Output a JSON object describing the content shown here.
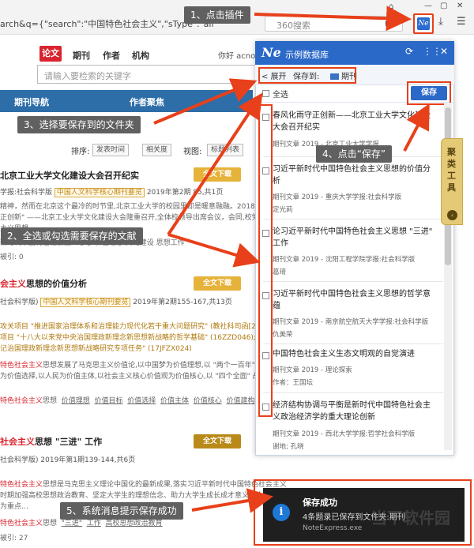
{
  "browser": {
    "url": "arch&q={\"search\":\"中国特色社会主义\",\"sType\":\"all\"}&",
    "search_placeholder": "360搜索"
  },
  "site": {
    "tabs": [
      "论文",
      "期刊",
      "作者",
      "机构"
    ],
    "greeting": "你好 acno",
    "keyword_placeholder": "请输入要检索的关键字",
    "nav": [
      "期刊导航",
      "作者聚焦"
    ],
    "sort_label": "排序:",
    "sort_chips": [
      "发表时间",
      "相关度"
    ],
    "view_label": "视图:",
    "view_chip": "标题列表"
  },
  "articles": [
    {
      "title": "北京工业大学文化建设大会召开纪实",
      "source": "学报:社会科学版",
      "tag": "中国人文科学核心期刊要览",
      "issue": "2019年第2期",
      "pages": "85,共1页",
      "lines": [
        "精神，然而在北京这个最冷的时节里,北京工业大学的校园里却是暖意融融。2018年12月",
        "正创新\" ——北京工业大学文化建设大会隆重召开,全体校领导出席会议，会同,校党委",
        "主义思想"
      ],
      "keyword_line": "新时代中国特色社会主义思想  价值理念  文化建设  思想工作",
      "count_label": "被引:",
      "count": "0",
      "download": "全文下载"
    },
    {
      "title_red": "会主义",
      "title": "思想的价值分析",
      "source": "社会科学版)",
      "tag": "中国人文科学核心期刊要览",
      "issue": "2019年第2期155-167,共13页",
      "lines": [
        "攻关项目 \"推进国家治理体系和治理能力现代化若干重大问题研究\" (教社科司函[2014",
        "项目 \"十八大以来党中央治国理政新理念新思想新战略的哲学基础\" (16ZZD046);教",
        "记治国理政新理念新思想新战略研究专项任务\" (17JFZX024)"
      ],
      "body_red": "特色社会主义",
      "body": "思想发展了马克思主义价值论,以中国梦为价值理想,以 \"两个一百年\" 为",
      "body2": "为价值选择,以人民为价值主体,以社会主义核心价值观为价值核心,以 \"四个全面\" 战略",
      "keywords": [
        "思想",
        "价值理想",
        "价值目标",
        "价值选择",
        "价值主体",
        "价值核心",
        "价值建构"
      ],
      "keyword_prefix": "特色社会主义",
      "download": "全文下载"
    },
    {
      "title_red": "社会主义",
      "title": "思想 \"三进\" 工作",
      "source": "社会科学版)",
      "issue": "2019年第1期139-144,共6页",
      "body_red": "特色社会主义",
      "body": "思想是马克思主义理论中国化的最新成果,落实习近平新时代中国特色社会主义",
      "body2": "时期加强高校思想政治教育、坚定大学生的理想信念、助力大学生成长成才意义重大。为",
      "body3": "为重点…",
      "keywords": [
        "思想",
        "\"三进\"",
        "工作",
        "高校思想政治教育"
      ],
      "keyword_prefix": "特色社会主义",
      "count_label": "被引:",
      "count": "27",
      "download": "全文下载"
    }
  ],
  "panel": {
    "title": "示例数据库",
    "expand": "< 展开",
    "save_to": "保存到:",
    "folder": "期刊",
    "select_all": "全选",
    "save": "保存",
    "items": [
      {
        "title": "春风化雨守正创新——北京工业大学文化建设大会召开纪实",
        "meta": "期刊文章    2019 - 北京工业大学学报",
        "author": ""
      },
      {
        "title": "习近平新时代中国特色社会主义思想的价值分析",
        "meta": "期刊文章    2019 - 重庆大学学报:社会科学版",
        "author": "定光莉"
      },
      {
        "title": "论习近平新时代中国特色社会主义思想 \"三进\" 工作",
        "meta": "期刊文章    2019 - 沈阳工程学院学报:社会科学版",
        "author": "葛琦"
      },
      {
        "title": "习近平新时代中国特色社会主义思想的哲学意蕴",
        "meta": "期刊文章    2019 - 南京航空航天大学学报:社会科学版",
        "author": "仇美荣"
      },
      {
        "title": "中国特色社会主义生态文明观的自觉演进",
        "meta": "期刊文章    2019 - 理论探索",
        "author": "作者：王国坛"
      },
      {
        "title": "经济结构协调与平衡是新时代中国特色社会主义政治经济学的重大理论创新",
        "meta": "期刊文章    2019 - 西北大学学报:哲学社会科学版",
        "author": "谢地; 孔晓"
      }
    ]
  },
  "side_tab": {
    "label": "聚类工具",
    "collapse": "‹"
  },
  "toast": {
    "title": "保存成功",
    "message": "4条题录已保存到文件夹:期刊",
    "app": "NoteExpress.exe",
    "icon": "i"
  },
  "annotations": {
    "step1": "1、点击插件",
    "step2": "2、全选或勾选需要保存的文献",
    "step3": "3、选择要保存到的文件夹",
    "step4": "4、点击“保存”",
    "step5": "5、系统消息提示保存成功"
  },
  "watermark": "当下软件园",
  "colors": {
    "accent": "#e8401a",
    "panel_blue": "#2b69c8",
    "cnki_red": "#d9242e",
    "nav_blue": "#2d6ea8"
  }
}
